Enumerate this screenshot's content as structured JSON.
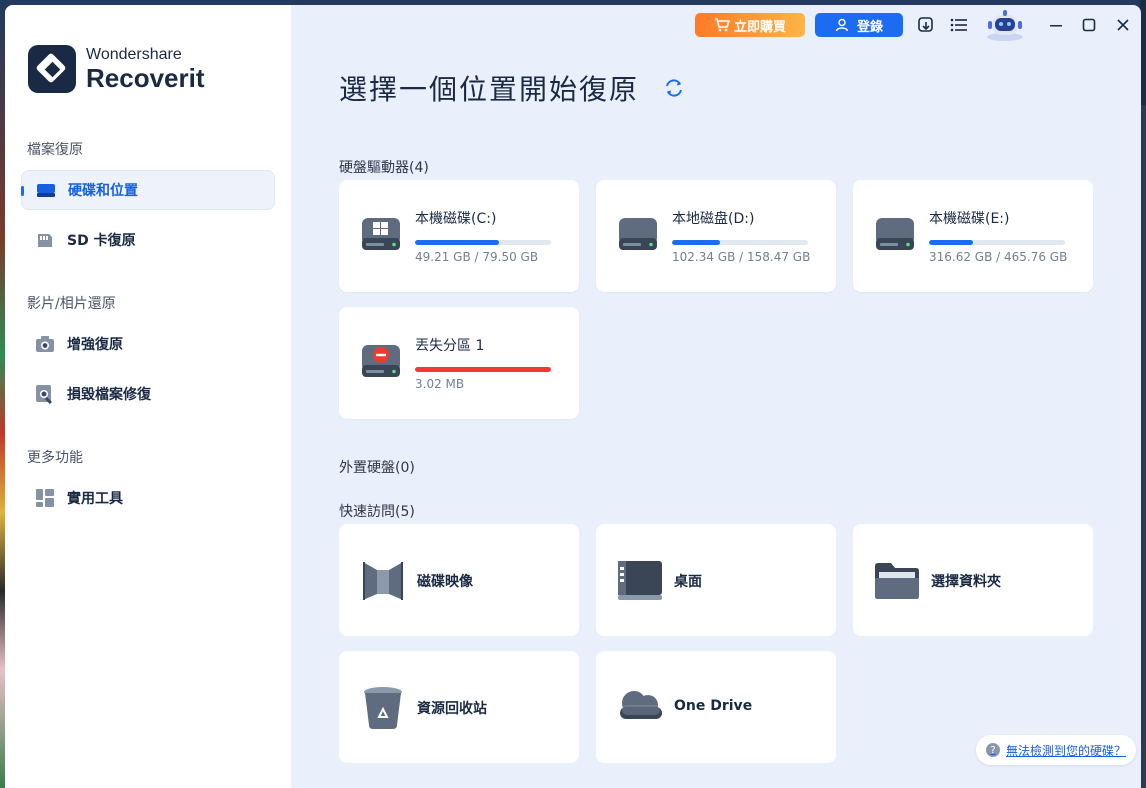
{
  "app": {
    "brand_sub": "Wondershare",
    "brand_main": "Recoverit"
  },
  "sidebar": {
    "sections": [
      {
        "title": "檔案復原",
        "items": [
          {
            "label": "硬碟和位置",
            "icon": "drive-icon",
            "active": true
          },
          {
            "label": "SD 卡復原",
            "icon": "sd-card-icon",
            "active": false
          }
        ]
      },
      {
        "title": "影片/相片還原",
        "items": [
          {
            "label": "增強復原",
            "icon": "camera-icon",
            "active": false
          },
          {
            "label": "損毀檔案修復",
            "icon": "repair-icon",
            "active": false
          }
        ]
      },
      {
        "title": "更多功能",
        "items": [
          {
            "label": "實用工具",
            "icon": "tools-icon",
            "active": false
          }
        ]
      }
    ]
  },
  "topbar": {
    "buy_label": "立即購買",
    "login_label": "登錄"
  },
  "main": {
    "title": "選擇一個位置開始復原",
    "hard_drives_title": "硬盤驅動器(4)",
    "drives": [
      {
        "name": "本機磁碟(C:)",
        "size": "49.21 GB / 79.50 GB",
        "used_fraction": 0.62,
        "type": "windows",
        "status": "normal"
      },
      {
        "name": "本地磁盘(D:)",
        "size": "102.34 GB / 158.47 GB",
        "used_fraction": 0.35,
        "type": "disk",
        "status": "normal"
      },
      {
        "name": "本機磁碟(E:)",
        "size": "316.62 GB / 465.76 GB",
        "used_fraction": 0.32,
        "type": "disk",
        "status": "normal"
      },
      {
        "name": "丟失分區 1",
        "size": "3.02 MB",
        "used_fraction": 1.0,
        "type": "lost",
        "status": "lost"
      }
    ],
    "external_title": "外置硬盤(0)",
    "quick_title": "快速訪問(5)",
    "quick": [
      {
        "label": "磁碟映像",
        "icon": "disk-image-icon"
      },
      {
        "label": "桌面",
        "icon": "desktop-icon"
      },
      {
        "label": "選擇資料夾",
        "icon": "folder-icon"
      },
      {
        "label": "資源回收站",
        "icon": "recycle-bin-icon"
      },
      {
        "label": "One Drive",
        "icon": "onedrive-icon"
      }
    ],
    "help_link": "無法檢測到您的硬碟？"
  },
  "colors": {
    "accent": "#1b6cf2",
    "danger": "#ef3a2f",
    "buy_start": "#ff7a2a",
    "buy_end": "#ffb545"
  }
}
